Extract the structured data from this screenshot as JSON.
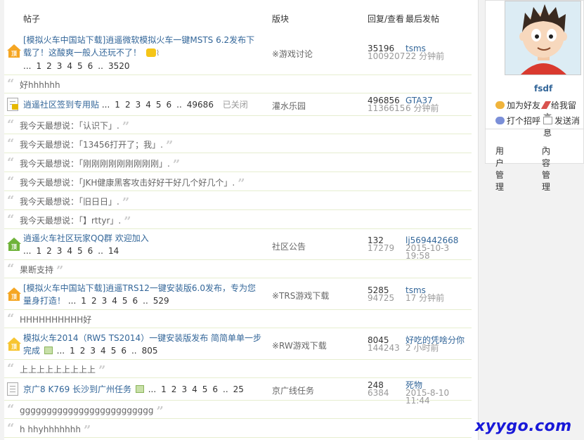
{
  "header": {
    "col_thread": "帖子",
    "col_forum": "版块",
    "col_stats": "回复/查看",
    "col_last": "最后发帖"
  },
  "threads": [
    {
      "title_line1": "[模拟火车中国站下载]逍遥微软模拟火车一键MSTS 6.2发布下",
      "title_line2": "载了！这酸爽一般人还玩不了！",
      "pages": [
        "...",
        "1",
        "2",
        "3",
        "4",
        "5",
        "6",
        "..",
        "3520"
      ],
      "forum": "※游戏讨论",
      "replies": "35196",
      "views": "1009207",
      "last_user": "tsms",
      "last_time": "22 分钟前"
    },
    {
      "title_line1": "逍遥社区签到专用贴",
      "pages": [
        "...",
        "1",
        "2",
        "3",
        "4",
        "5",
        "6",
        "..",
        "49686"
      ],
      "closed": "已关闭",
      "forum": "灌水乐园",
      "replies": "496856",
      "views": "1136615",
      "last_user": "GTA37",
      "last_time": "6 分钟前"
    },
    {
      "title_line1": "逍遥火车社区玩家QQ群 欢迎加入",
      "pages": [
        "...",
        "1",
        "2",
        "3",
        "4",
        "5",
        "6",
        "..",
        "14"
      ],
      "forum": "社区公告",
      "replies": "132",
      "views": "17279",
      "last_user": "lj569442668",
      "last_time": "2015-10-3 19:58"
    },
    {
      "title_line1": "[模拟火车中国站下载]逍遥TRS12一键安装版6.0发布，专为您",
      "title_line2": "量身打造！",
      "pages": [
        "...",
        "1",
        "2",
        "3",
        "4",
        "5",
        "6",
        "..",
        "529"
      ],
      "forum": "※TRS游戏下载",
      "replies": "5285",
      "views": "94725",
      "last_user": "tsms",
      "last_time": "17 分钟前"
    },
    {
      "title_line1": "模拟火车2014（RW5 TS2014）一键安装版发布 简简单单一步",
      "title_line2": "完成",
      "pages": [
        "...",
        "1",
        "2",
        "3",
        "4",
        "5",
        "6",
        "..",
        "805"
      ],
      "forum": "※RW游戏下载",
      "replies": "8045",
      "views": "144243",
      "last_user": "好吃的凭啥分你",
      "last_time": "2 小时前"
    },
    {
      "title_line1": "京广8 K769 长沙到广州任务",
      "pages": [
        "...",
        "1",
        "2",
        "3",
        "4",
        "5",
        "6",
        "..",
        "25"
      ],
      "forum": "京广线任务",
      "replies": "248",
      "views": "6384",
      "last_user": "死物",
      "last_time": "2015-8-10 11:44"
    }
  ],
  "quotes": {
    "q0": "好hhhhhh",
    "q1": "我今天最想说：「认识下」.",
    "q2": "我今天最想说：「13456打开了；我」.",
    "q3": "我今天最想说：「刚刚刚刚刚刚刚刚刚」.",
    "q4": "我今天最想说：「JKH健康黑客攻击好好干好几个好几个」.",
    "q5": "我今天最想说：「旧日日」.",
    "q6": "我今天最想说：「】rttyr」.",
    "q7": "果断支持",
    "q8": "HHHHHHHHHH好",
    "q9": "上上上上上上上上上",
    "q10": "ggggggggggggggggggggggggg",
    "q11": "h hhyhhhhhhh"
  },
  "quote_marks": {
    "open": "“",
    "close": "”"
  },
  "top_badge": "顶",
  "profile": {
    "username": "fsdf",
    "add_friend": "加为好友",
    "leave_msg": "给我留言",
    "greet": "打个招呼",
    "send_msg": "发送消息",
    "user_mgmt": "用户管理",
    "content_mgmt": "内容管理",
    "caret": "▾"
  },
  "watermark": "xyygo.com"
}
